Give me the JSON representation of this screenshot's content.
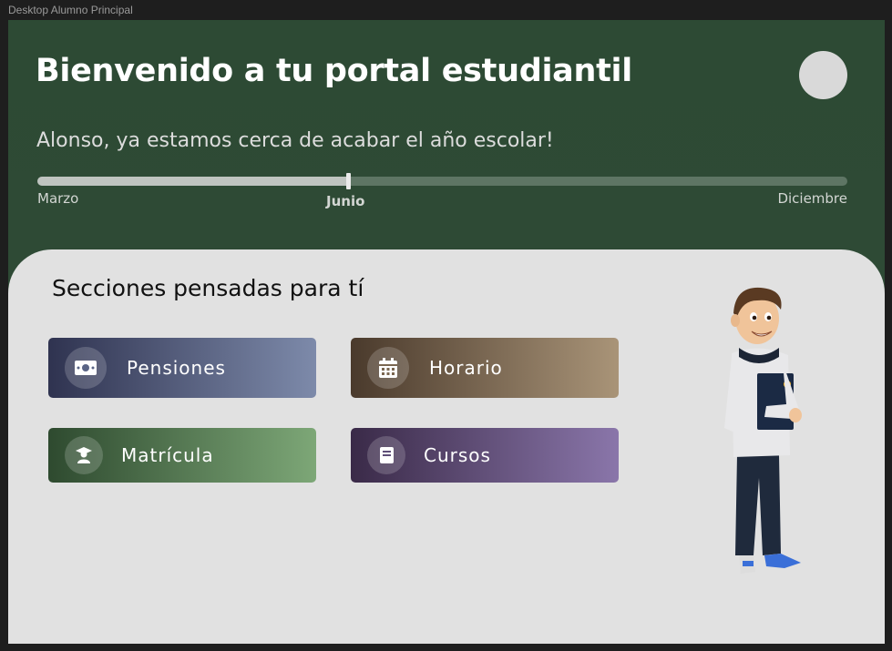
{
  "window": {
    "frame_label": "Desktop Alumno Principal"
  },
  "header": {
    "title": "Bienvenido a tu portal estudiantil",
    "subtitle": "Alonso, ya estamos cerca de acabar el año escolar!"
  },
  "progress": {
    "start_label": "Marzo",
    "current_label": "Junio",
    "end_label": "Diciembre",
    "fraction": 0.384
  },
  "sections": {
    "title": "Secciones pensadas para tí",
    "cards": [
      {
        "label": "Pensiones",
        "icon": "money-bill-icon"
      },
      {
        "label": "Horario",
        "icon": "calendar-icon"
      },
      {
        "label": "Matrícula",
        "icon": "graduate-icon"
      },
      {
        "label": "Cursos",
        "icon": "book-icon"
      }
    ]
  },
  "colors": {
    "header_bg": "#2d4a34",
    "panel_bg": "#e1e1e1",
    "pensiones": [
      "#2f3350",
      "#7d8aaa"
    ],
    "horario": [
      "#4a3a2c",
      "#a99478"
    ],
    "matricula": [
      "#2e4a2f",
      "#7da777"
    ],
    "cursos": [
      "#3a2a48",
      "#8a76aa"
    ]
  }
}
